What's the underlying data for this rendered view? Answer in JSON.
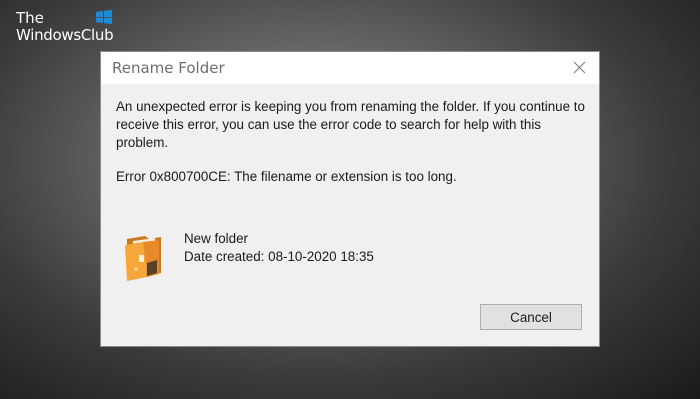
{
  "watermark": {
    "line1": "The",
    "line2": "WindowsClub",
    "logo_color": "#1e8ad6"
  },
  "dialog": {
    "title": "Rename Folder",
    "close_icon": "close-icon",
    "message": "An unexpected error is keeping you from renaming the folder. If you continue to receive this error, you can use the error code to search for help with this problem.",
    "error_code_text": "Error 0x800700CE: The filename or extension is too long.",
    "file": {
      "icon": "folder-icon",
      "name": "New folder",
      "date_label": "Date created:",
      "date_value": "08-10-2020 18:35"
    },
    "cancel_label": "Cancel"
  },
  "colors": {
    "dialog_body_bg": "#f0f0f0",
    "titlebar_bg": "#ffffff",
    "button_bg": "#e1e1e1",
    "button_border": "#adadad",
    "folder_orange": "#f59a2e"
  }
}
